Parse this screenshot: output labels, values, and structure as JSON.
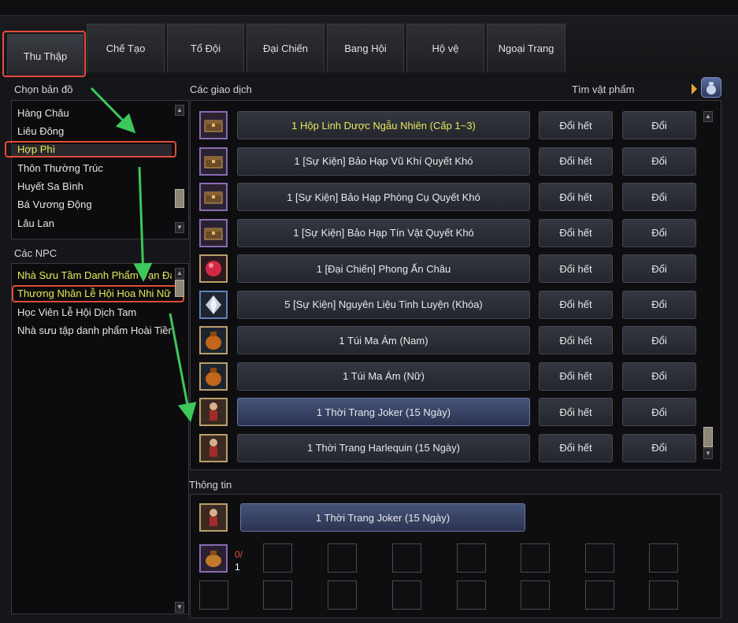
{
  "tabs": [
    "Thu Thập",
    "Chế Tạo",
    "Tổ Đội",
    "Đại Chiến",
    "Bang Hội",
    "Hộ vệ",
    "Ngoại Trang"
  ],
  "map_panel": {
    "title": "Chọn bản đồ",
    "items": [
      "Hàng Châu",
      "Liêu Đông",
      "Hợp Phì",
      "Thôn Thường Trúc",
      "Huyết Sa Bình",
      "Bá Vương Động",
      "Lâu Lan"
    ],
    "selected_index": 2
  },
  "npc_panel": {
    "title": "Các NPC",
    "items": [
      "Nhà Sưu Tầm Danh Phẩm Vạn Đa",
      "Thương Nhân Lễ Hội Hoa Nhi Nữ",
      "Học Viên Lễ Hội Dịch Tam",
      "Nhà sưu tập danh phẩm Hoài Tiền"
    ],
    "selected_index": 1
  },
  "trade_panel": {
    "title": "Các giao dịch",
    "search_label": "Tìm vật phẩm",
    "exchange_all_label": "Đổi hết",
    "exchange_label": "Đổi",
    "rows": [
      {
        "name": "1 Hộp Linh Dược Ngẫu Nhiên (Cấp 1~3)",
        "icon": "chest-icon"
      },
      {
        "name": "1 [Sự Kiện] Bảo Hạp Vũ Khí Quyết Khó",
        "icon": "chest-icon"
      },
      {
        "name": "1 [Sự Kiện] Bảo Hạp Phòng Cụ Quyết Khó",
        "icon": "chest-icon"
      },
      {
        "name": "1 [Sự Kiện] Bảo Hạp Tín Vật Quyết Khó",
        "icon": "chest-icon"
      },
      {
        "name": "1 [Đại Chiến] Phong Ấn Châu",
        "icon": "red-gem-icon"
      },
      {
        "name": "5 [Sự Kiện] Nguyên Liệu Tinh Luyện (Khóa)",
        "icon": "crystal-icon"
      },
      {
        "name": "1 Túi Ma Ám (Nam)",
        "icon": "bag-icon"
      },
      {
        "name": "1 Túi Ma Ám (Nữ)",
        "icon": "bag-icon"
      },
      {
        "name": "1 Thời Trang Joker (15 Ngày)",
        "icon": "costume-icon"
      },
      {
        "name": "1 Thời Trang Harlequin (15 Ngày)",
        "icon": "costume-icon"
      }
    ],
    "highlighted_row": 0,
    "selected_row": 8
  },
  "info_panel": {
    "title": "Thông tin",
    "item_name": "1 Thời Trang Joker (15 Ngày)",
    "req_count": "0/",
    "req_total": "1"
  },
  "colors": {
    "accent_yellow": "#e8e85a",
    "highlight_red": "#e34b3a",
    "arrow_green": "#3cc85a"
  }
}
